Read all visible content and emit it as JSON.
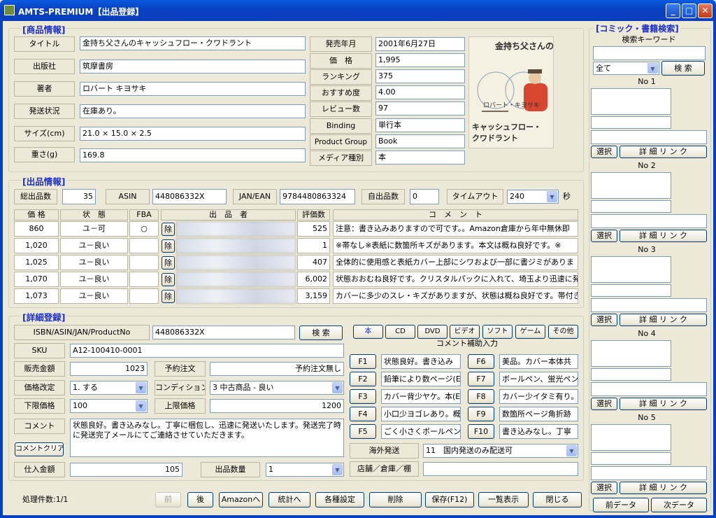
{
  "window": {
    "title": "AMTS-PREMIUM【出品登録】",
    "min": "_",
    "max": "□",
    "close": "✕"
  },
  "product": {
    "section": "[商品情報]",
    "title_label": "タイトル",
    "title": "金持ち父さんのキャッシュフロー・クワドラント",
    "publisher_label": "出版社",
    "publisher": "筑摩書房",
    "author_label": "著者",
    "author": "ロバート キヨサキ",
    "shipping_label": "発送状況",
    "shipping": "在庫あり。",
    "size_label": "サイズ(cm)",
    "size": "21.0 × 15.0 × 2.5",
    "weight_label": "重さ(g)",
    "weight": "169.8",
    "release_label": "発売年月",
    "release": "2001年6月27日",
    "price_label": "価　格",
    "price": "1,995",
    "ranking_label": "ランキング",
    "ranking": "375",
    "recommend_label": "おすすめ度",
    "recommend": "4.00",
    "reviews_label": "レビュー数",
    "reviews": "97",
    "binding_label": "Binding",
    "binding": "単行本",
    "group_label": "Product Group",
    "group": "Book",
    "media_label": "メディア種別",
    "media": "本",
    "cover": {
      "line1": "金持ち父さんの",
      "line2": "キャッシュフロー・",
      "line3": "クワドラント",
      "author": "ロバート・キヨサキ"
    }
  },
  "listing": {
    "section": "[出品情報]",
    "total_label": "総出品数",
    "total": "35",
    "asin_label": "ASIN",
    "asin": "448086332X",
    "jan_label": "JAN/EAN",
    "jan": "9784480863324",
    "own_label": "自出品数",
    "own": "0",
    "timeout_label": "タイムアウト",
    "timeout": "240",
    "sec": "秒",
    "headers": {
      "price": "価 格",
      "cond": "状　態",
      "fba": "FBA",
      "seller": "出　品　者",
      "rating": "評価数",
      "comment": "コ　メ　ン　ト"
    },
    "remove": "除",
    "rows": [
      {
        "price": "860",
        "cond": "ユ－可",
        "fba": "○",
        "rating": "525",
        "comment": "注意：書き込みありますので可です。。Amazon倉庫から年中無休即"
      },
      {
        "price": "1,020",
        "cond": "ユ－良い",
        "fba": "",
        "rating": "1",
        "comment": "※帯なし※表紙に数箇所キズがあります。本文は概ね良好です。※"
      },
      {
        "price": "1,025",
        "cond": "ユ－良い",
        "fba": "",
        "rating": "407",
        "comment": "全体的に使用感と表紙カバー上部にシワおよび一部に書ジミがありま"
      },
      {
        "price": "1,070",
        "cond": "ユ－良い",
        "fba": "",
        "rating": "6,002",
        "comment": "状態おおむね良好です。クリスタルパックに入れて、埼玉より迅速に発"
      },
      {
        "price": "1,073",
        "cond": "ユ－良い",
        "fba": "",
        "rating": "3,159",
        "comment": "カバーに多少のスレ・キズがありますが、状態は概ね良好です。帯付き"
      }
    ]
  },
  "detail": {
    "section": "[詳細登録]",
    "isbn_label": "ISBN/ASIN/JAN/ProductNo",
    "isbn": "448086332X",
    "search": "検 索",
    "sku_label": "SKU",
    "sku": "A12-100410-0001",
    "sale_label": "販売金額",
    "sale": "1023",
    "preorder_label": "予約注文",
    "preorder": "予約注文無し",
    "revise_label": "価格改定",
    "revise": "1. する",
    "condition_label": "コンディション",
    "condition": "3 中古商品 - 良い",
    "min_label": "下限価格",
    "min": "100",
    "max_label": "上限価格",
    "max": "1200",
    "comment_label": "コメント",
    "comment": "状態良好。書き込みなし。丁寧に梱包し、迅速に発送いたします。発送完了時に発送完了メールにてご連絡させていただきます。",
    "clear": "コメントクリア",
    "cost_label": "仕入金額",
    "cost": "105",
    "qty_label": "出品数量",
    "qty": "1",
    "cat_buttons": [
      "本",
      "CD",
      "DVD",
      "ビデオ",
      "ソフト",
      "ゲーム",
      "その他"
    ],
    "assist_title": "コメント補助入力",
    "fkeys": [
      {
        "key": "F1",
        "text": "状態良好。書き込み"
      },
      {
        "key": "F6",
        "text": "美品。カバー本体共"
      },
      {
        "key": "F2",
        "text": "鉛筆により数ページ(E"
      },
      {
        "key": "F7",
        "text": "ボールペン、蛍光ペン"
      },
      {
        "key": "F3",
        "text": "カバー背少ヤケ。本(E"
      },
      {
        "key": "F8",
        "text": "カバー少イタミ有り。ス"
      },
      {
        "key": "F4",
        "text": "小口少ヨゴレあり。概"
      },
      {
        "key": "F9",
        "text": "数箇所ページ角折跡"
      },
      {
        "key": "F5",
        "text": "ごく小さくボールペン("
      },
      {
        "key": "F10",
        "text": "書き込みなし。丁寧"
      }
    ],
    "overseas_label": "海外発送",
    "overseas": "11　国内発送のみ配送可",
    "store_label": "店舗／倉庫／棚",
    "store": ""
  },
  "footer": {
    "count": "処理件数:1/1",
    "buttons": [
      "前",
      "後",
      "Amazonへ",
      "統計へ",
      "各種設定",
      "削除",
      "保存(F12)",
      "一覧表示",
      "閉じる"
    ]
  },
  "right": {
    "section": "[コミック・書籍検索]",
    "kw_label": "検索キーワード",
    "keyword": "",
    "filter": "全て",
    "search": "検 索",
    "items": [
      {
        "no": "No 1"
      },
      {
        "no": "No 2"
      },
      {
        "no": "No 3"
      },
      {
        "no": "No 4"
      },
      {
        "no": "No 5"
      }
    ],
    "select": "選択",
    "link": "詳 細 リ ン ク",
    "prev": "前データ",
    "next": "次データ"
  }
}
